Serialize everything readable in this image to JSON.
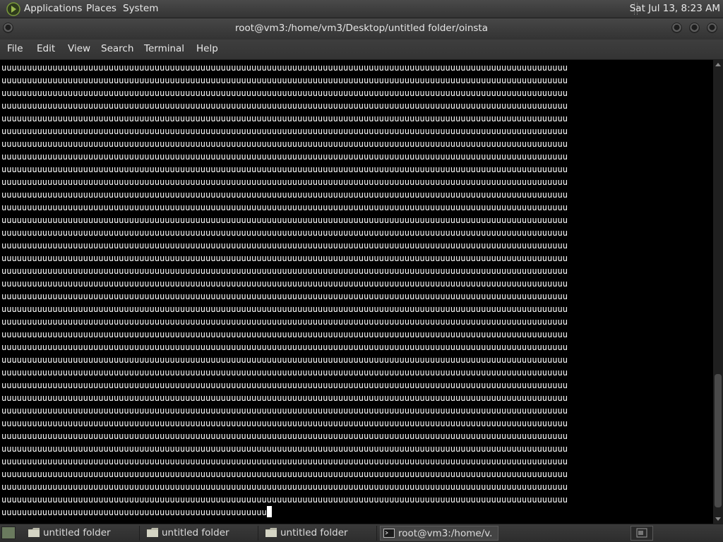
{
  "top_panel": {
    "menus": [
      "Applications",
      "Places",
      "System"
    ],
    "clock": "Sat Jul 13,  8:23 AM",
    "logo_icon": "distro-logo-icon"
  },
  "window": {
    "title": "root@vm3:/home/vm3/Desktop/untitled folder/oinsta",
    "buttons": [
      "window-menu-icon",
      "minimize-icon",
      "maximize-icon",
      "close-icon"
    ]
  },
  "menubar": {
    "items": [
      "File",
      "Edit",
      "View",
      "Search",
      "Terminal",
      "Help"
    ]
  },
  "terminal": {
    "line_char": "u",
    "full_line_length": 111,
    "full_line_count": 35,
    "last_line_length": 52,
    "cursor_visible": true,
    "background": "#000000",
    "foreground": "#ffffff"
  },
  "scrollbar": {
    "position_fraction": 0.98,
    "visible_fraction": 0.3
  },
  "taskbar": {
    "tasks": [
      {
        "label": "untitled folder",
        "icon": "folder-icon",
        "active": false
      },
      {
        "label": "untitled folder",
        "icon": "folder-icon",
        "active": false
      },
      {
        "label": "untitled folder",
        "icon": "folder-icon",
        "active": false
      },
      {
        "label": "root@vm3:/home/v...",
        "icon": "terminal-icon",
        "active": true
      }
    ]
  },
  "colors": {
    "panel": "#3c3c3c",
    "logo_green": "#7a9a3a"
  }
}
